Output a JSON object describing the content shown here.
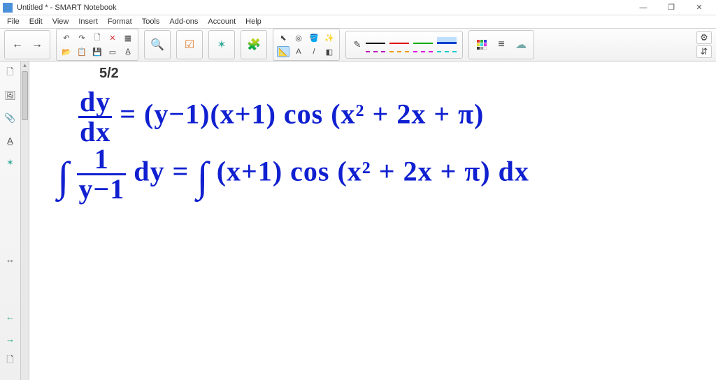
{
  "window": {
    "title": "Untitled * - SMART Notebook",
    "minimize": "—",
    "maximize": "❐",
    "close": "✕"
  },
  "menu": {
    "items": [
      "File",
      "Edit",
      "View",
      "Insert",
      "Format",
      "Tools",
      "Add-ons",
      "Account",
      "Help"
    ]
  },
  "toolbar": {
    "nav_prev": "←",
    "nav_next": "→",
    "undo": "↶",
    "redo": "↷",
    "new_page": "🗋",
    "delete": "✕",
    "table": "▦",
    "open": "📂",
    "save": "💾",
    "screen": "▭",
    "doc_cam": "A̲",
    "zoom": "🔍",
    "checkbox": "☑",
    "addon": "✶",
    "puzzle": "🧩",
    "select": "⬉",
    "pointer_tools": "◎",
    "fill": "🪣",
    "wand": "✨",
    "measure": "📐",
    "text": "A",
    "line": "/",
    "eraser": "◧",
    "pen": "✎",
    "color_swatch": "▦",
    "align": "≡",
    "cloud": "☁",
    "settings": "⚙",
    "resize": "⇵"
  },
  "leftrail": {
    "page": "🗋",
    "gallery": "🖼",
    "attach": "📎",
    "props": "A̲",
    "addons": "✶",
    "drag": "↔",
    "prev": "←",
    "next": "→",
    "page_icon": "🗋"
  },
  "canvas": {
    "page_label": "5/2",
    "line1_lhs_num": "dy",
    "line1_lhs_den": "dx",
    "line1_rhs": " = (y−1)(x+1) cos (x² + 2x + π)",
    "line2_int1": "∫",
    "line2_frac_num": "1",
    "line2_frac_den": "y−1",
    "line2_dy": " dy = ",
    "line2_int2": "∫",
    "line2_rhs": " (x+1) cos (x² + 2x + π) dx"
  },
  "colors": {
    "ink": "#1020d0",
    "accent": "#4a90d9"
  }
}
